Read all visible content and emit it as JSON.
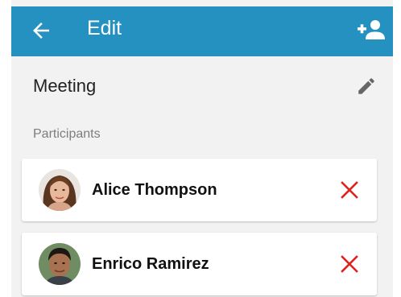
{
  "appbar": {
    "title": "Edit",
    "back_icon": "arrow-left-icon",
    "add_icon": "person-add-icon",
    "color": "#2491c0"
  },
  "meeting": {
    "title": "Meeting",
    "edit_icon": "pencil-icon"
  },
  "participants": {
    "label": "Participants",
    "remove_icon": "close-x-icon",
    "remove_color": "#e0221e",
    "items": [
      {
        "name": "Alice Thompson",
        "avatar": "avatar-photo"
      },
      {
        "name": "Enrico Ramirez",
        "avatar": "avatar-photo"
      }
    ]
  }
}
